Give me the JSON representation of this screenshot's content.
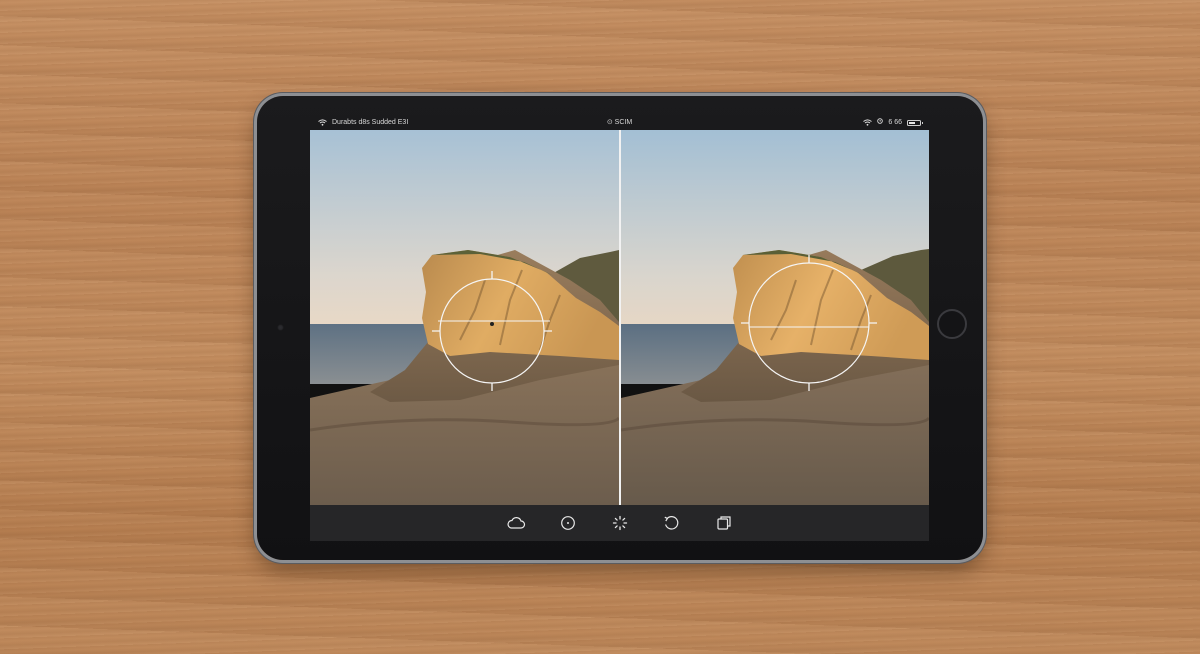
{
  "status_bar": {
    "left_text": "Durabts d8s Sudded E3I",
    "center_text": "⊙ SCIM",
    "right_text": "6 66",
    "battery_level": 0.55
  },
  "compare_view": {
    "before_focus_ring_size": "small",
    "after_focus_ring_size": "large"
  },
  "toolbar": {
    "tools": [
      {
        "icon": "cloud-icon"
      },
      {
        "icon": "target-icon"
      },
      {
        "icon": "loading-spinner-icon"
      },
      {
        "icon": "rotate-icon"
      },
      {
        "icon": "copy-icon"
      }
    ]
  },
  "colors": {
    "bezel": "#151517",
    "toolbar": "#262628",
    "sky_top": "#a9c3d6",
    "sky_bottom": "#e3d6c8",
    "rock_lit": "#d9a35d",
    "sand": "#7c6b57"
  }
}
